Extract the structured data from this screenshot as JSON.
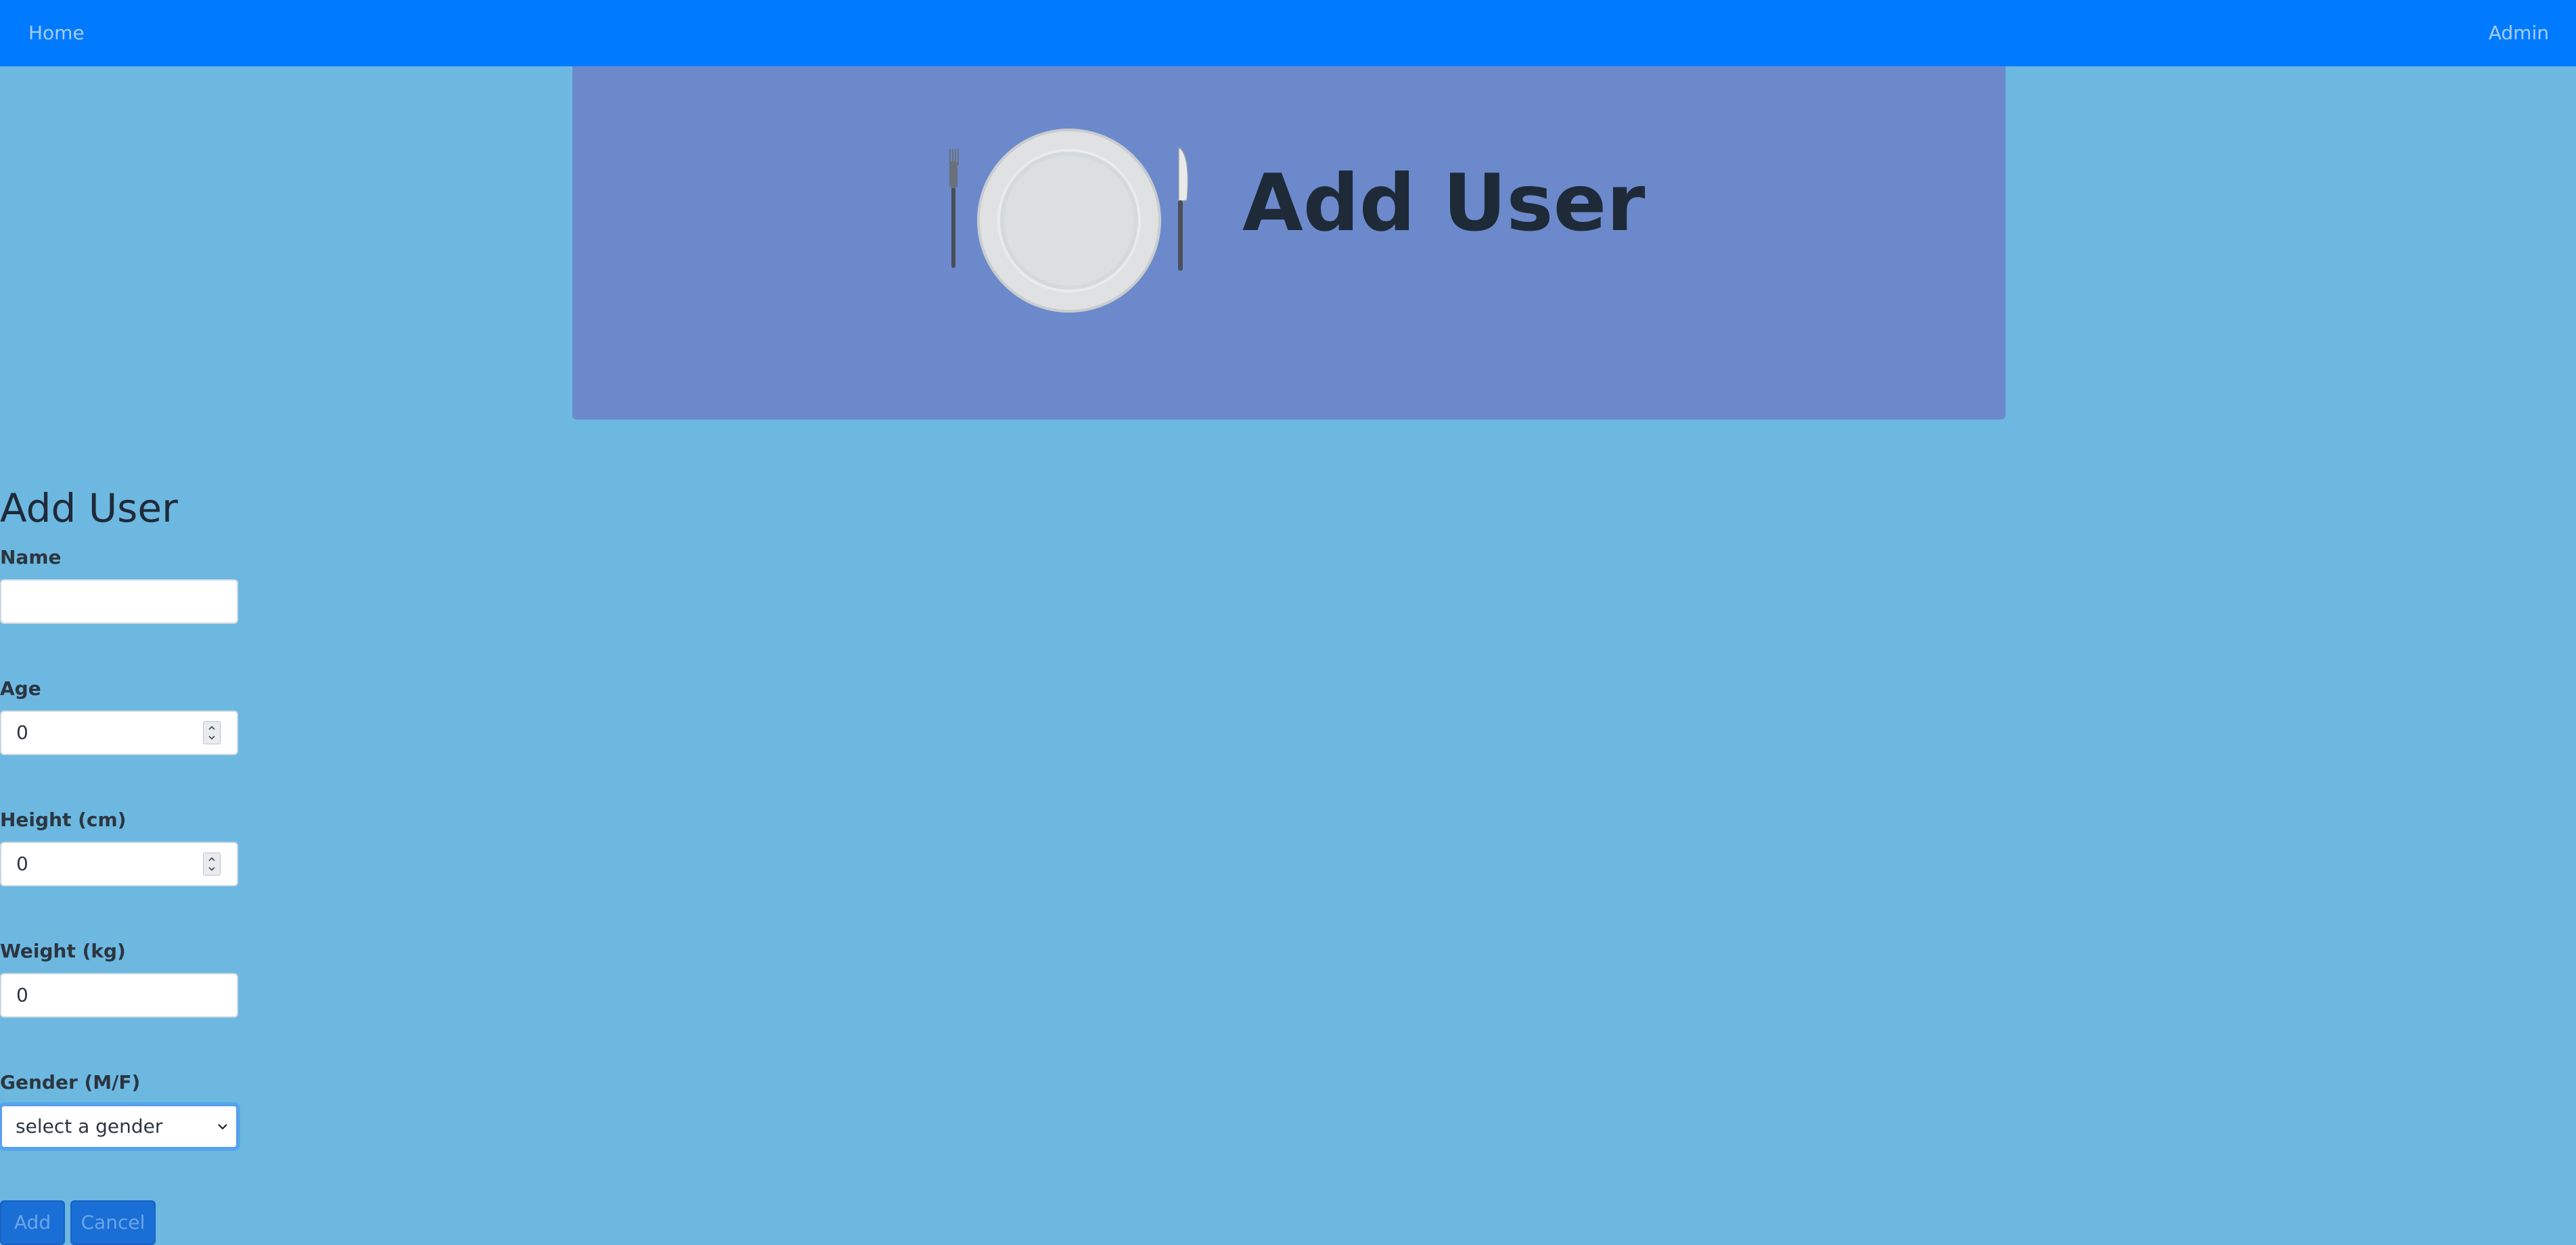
{
  "nav": {
    "home_label": "Home",
    "admin_label": "Admin"
  },
  "hero": {
    "title": "Add User",
    "logo_icon": "plate-fork-knife-icon"
  },
  "form": {
    "title": "Add User",
    "name": {
      "label": "Name",
      "value": ""
    },
    "age": {
      "label": "Age",
      "value": "0"
    },
    "height": {
      "label": "Height (cm)",
      "value": "0"
    },
    "weight": {
      "label": "Weight (kg)",
      "value": "0"
    },
    "gender": {
      "label": "Gender (M/F)",
      "selected": "select a gender"
    },
    "add_label": "Add",
    "cancel_label": "Cancel"
  },
  "colors": {
    "navbar": "#007bff",
    "page_background": "#6cb8e0",
    "hero_background": "#6c89cc",
    "button": "#1a6fd6"
  }
}
